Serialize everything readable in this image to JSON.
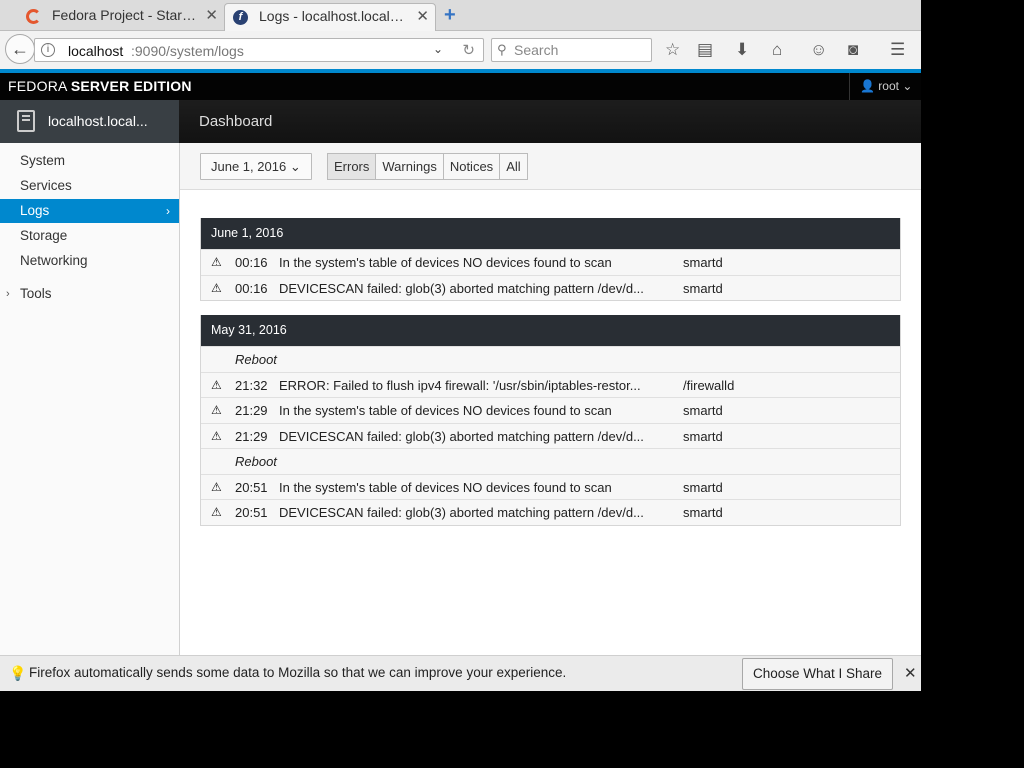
{
  "browser": {
    "tabs": [
      {
        "title": "Fedora Project - Star…",
        "active": false
      },
      {
        "title": "Logs - localhost.local…",
        "active": true
      }
    ],
    "url_host": "localhost",
    "url_path": ":9090/system/logs",
    "search_placeholder": "Search"
  },
  "header": {
    "brand_light": "FEDORA ",
    "brand_bold": "SERVER EDITION",
    "user": "root"
  },
  "hostbar": {
    "host": "localhost.local...",
    "dashboard": "Dashboard"
  },
  "sidebar": {
    "items": [
      {
        "label": "System"
      },
      {
        "label": "Services"
      },
      {
        "label": "Logs",
        "active": true
      },
      {
        "label": "Storage"
      },
      {
        "label": "Networking"
      },
      {
        "label": "Tools"
      }
    ]
  },
  "filters": {
    "date": "June 1, 2016",
    "priorities": [
      "Errors",
      "Warnings",
      "Notices",
      "All"
    ],
    "selected": "Errors"
  },
  "log_groups": [
    {
      "date": "June 1, 2016",
      "rows": [
        {
          "type": "entry",
          "time": "00:16",
          "message": "In the system's table of devices NO devices found to scan",
          "source": "smartd"
        },
        {
          "type": "entry",
          "time": "00:16",
          "message": "DEVICESCAN failed: glob(3) aborted matching pattern /dev/d...",
          "source": "smartd"
        }
      ]
    },
    {
      "date": "May 31, 2016",
      "rows": [
        {
          "type": "reboot",
          "message": "Reboot"
        },
        {
          "type": "entry",
          "time": "21:32",
          "message": "ERROR: Failed to flush ipv4 firewall: '/usr/sbin/iptables-restor...",
          "source": "/firewalld"
        },
        {
          "type": "entry",
          "time": "21:29",
          "message": "In the system's table of devices NO devices found to scan",
          "source": "smartd"
        },
        {
          "type": "entry",
          "time": "21:29",
          "message": "DEVICESCAN failed: glob(3) aborted matching pattern /dev/d...",
          "source": "smartd"
        },
        {
          "type": "reboot",
          "message": "Reboot"
        },
        {
          "type": "entry",
          "time": "20:51",
          "message": "In the system's table of devices NO devices found to scan",
          "source": "smartd"
        },
        {
          "type": "entry",
          "time": "20:51",
          "message": "DEVICESCAN failed: glob(3) aborted matching pattern /dev/d...",
          "source": "smartd"
        }
      ]
    }
  ],
  "notification": {
    "text": "Firefox automatically sends some data to Mozilla so that we can improve your experience.",
    "button": "Choose What I Share"
  },
  "colors": {
    "accent": "#0088ce",
    "topbar": "#030303",
    "log_header": "#292e34"
  }
}
